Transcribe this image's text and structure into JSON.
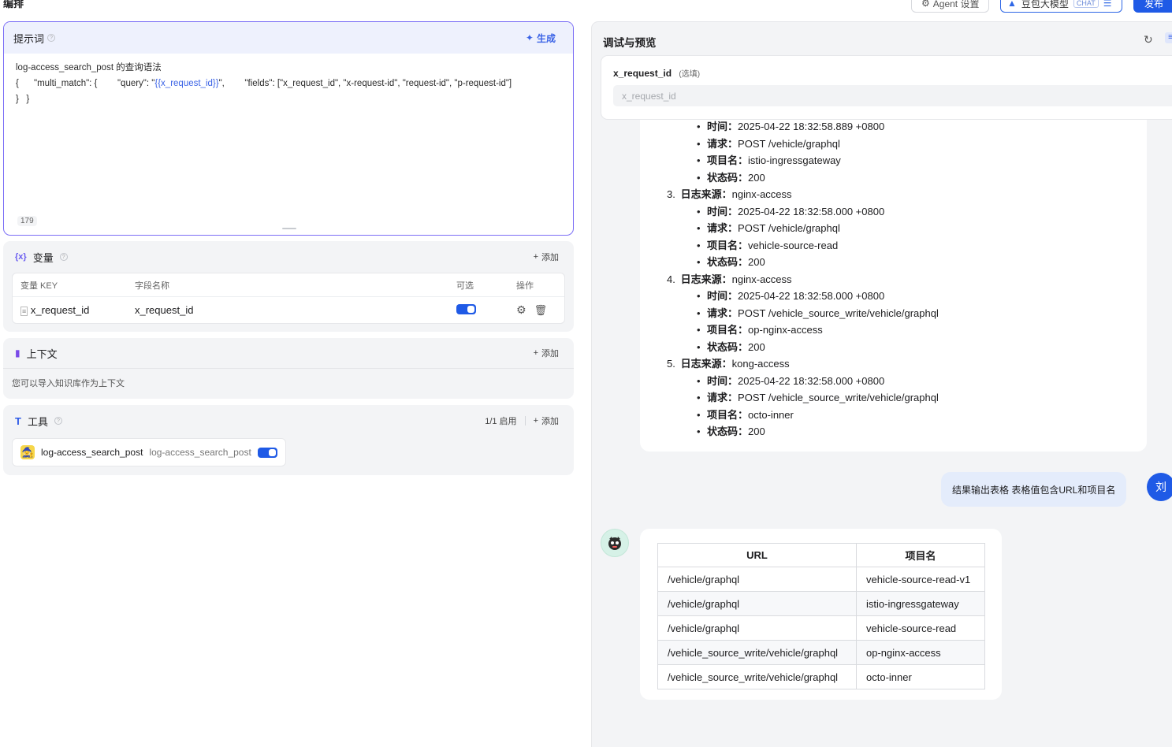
{
  "header": {
    "page_title": "编排",
    "agent_settings_label": "Agent 设置",
    "model_label": "豆包大模型",
    "model_badge": "CHAT",
    "publish_label": "发布"
  },
  "prompt": {
    "title": "提示词",
    "generate_label": "生成",
    "line1": "log-access_search_post 的查询语法",
    "line2_a": "{      \"multi_match\": {        \"query\": \"",
    "line2_var": "{{x_request_id}}",
    "line2_b": "\",        \"fields\": [\"x_request_id\", \"x-request-id\", \"request-id\", \"p-request-id\"]",
    "line3": "}   }",
    "char_count": "179"
  },
  "variables": {
    "title": "变量",
    "add_label": "添加",
    "columns": [
      "变量 KEY",
      "字段名称",
      "可选",
      "操作"
    ],
    "rows": [
      {
        "key": "x_request_id",
        "field": "x_request_id"
      }
    ]
  },
  "context": {
    "title": "上下文",
    "add_label": "添加",
    "hint": "您可以导入知识库作为上下文"
  },
  "tools": {
    "title": "工具",
    "status": "1/1 启用",
    "add_label": "添加",
    "items": [
      {
        "name": "log-access_search_post",
        "desc": "log-access_search_post"
      }
    ]
  },
  "preview": {
    "title": "调试与预览",
    "input_label": "x_request_id",
    "input_optional": "(选填)",
    "input_placeholder": "x_request_id",
    "partial_entry": [
      {
        "label": "时间",
        "value": "2025-04-22 18:32:58.889 +0800"
      },
      {
        "label": "请求",
        "value": "POST /vehicle/graphql"
      },
      {
        "label": "项目名",
        "value": "istio-ingressgateway"
      },
      {
        "label": "状态码",
        "value": "200"
      }
    ],
    "entries": [
      {
        "num": "3.",
        "label": "日志来源",
        "value": "nginx-access",
        "fields": [
          {
            "label": "时间",
            "value": "2025-04-22 18:32:58.000 +0800"
          },
          {
            "label": "请求",
            "value": "POST /vehicle/graphql"
          },
          {
            "label": "项目名",
            "value": "vehicle-source-read"
          },
          {
            "label": "状态码",
            "value": "200"
          }
        ]
      },
      {
        "num": "4.",
        "label": "日志来源",
        "value": "nginx-access",
        "fields": [
          {
            "label": "时间",
            "value": "2025-04-22 18:32:58.000 +0800"
          },
          {
            "label": "请求",
            "value": "POST /vehicle_source_write/vehicle/graphql"
          },
          {
            "label": "项目名",
            "value": "op-nginx-access"
          },
          {
            "label": "状态码",
            "value": "200"
          }
        ]
      },
      {
        "num": "5.",
        "label": "日志来源",
        "value": "kong-access",
        "fields": [
          {
            "label": "时间",
            "value": "2025-04-22 18:32:58.000 +0800"
          },
          {
            "label": "请求",
            "value": "POST /vehicle_source_write/vehicle/graphql"
          },
          {
            "label": "项目名",
            "value": "octo-inner"
          },
          {
            "label": "状态码",
            "value": "200"
          }
        ]
      }
    ],
    "user_message": "结果输出表格 表格值包含URL和项目名",
    "user_avatar_text": "刘",
    "table": {
      "headers": [
        "URL",
        "项目名"
      ],
      "rows": [
        [
          "/vehicle/graphql",
          "vehicle-source-read-v1"
        ],
        [
          "/vehicle/graphql",
          "istio-ingressgateway"
        ],
        [
          "/vehicle/graphql",
          "vehicle-source-read"
        ],
        [
          "/vehicle_source_write/vehicle/graphql",
          "op-nginx-access"
        ],
        [
          "/vehicle_source_write/vehicle/graphql",
          "octo-inner"
        ]
      ]
    }
  }
}
